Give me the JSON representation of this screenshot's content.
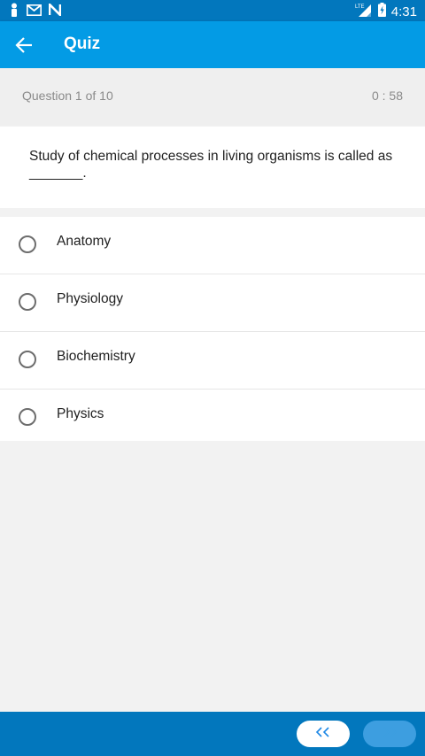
{
  "status_bar": {
    "time": "4:31",
    "network": "LTE",
    "icons": [
      "person-icon",
      "gmail-icon",
      "n-app-icon",
      "signal-icon",
      "battery-charging-icon"
    ]
  },
  "app_bar": {
    "title": "Quiz",
    "back_icon": "arrow-back-icon"
  },
  "quiz": {
    "progress_label": "Question 1 of  10",
    "timer": "0 : 58",
    "question": "Study of chemical processes in living organisms is called as _______.",
    "options": [
      {
        "label": "Anatomy",
        "selected": false
      },
      {
        "label": "Physiology",
        "selected": false
      },
      {
        "label": "Biochemistry",
        "selected": false
      },
      {
        "label": "Physics",
        "selected": false
      }
    ]
  },
  "navigation": {
    "prev_label": "‹‹",
    "prev_icon": "double-chevron-left-icon",
    "next_icon": "double-chevron-right-icon"
  },
  "colors": {
    "status_bar": "#0277bd",
    "app_bar": "#039be5",
    "bottom_bar": "#0277bd",
    "background": "#f2f2f2"
  }
}
